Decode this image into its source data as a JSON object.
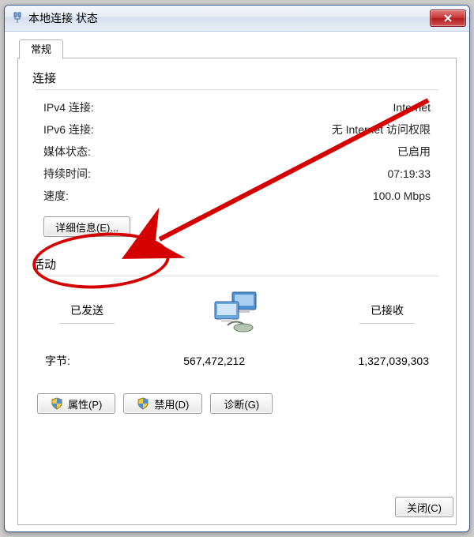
{
  "window": {
    "title": "本地连接 状态",
    "titleicon_name": "network-adapter-icon"
  },
  "tabs": {
    "general": "常规"
  },
  "conn": {
    "section_label": "连接",
    "ipv4_label": "IPv4 连接:",
    "ipv4_value": "Internet",
    "ipv6_label": "IPv6 连接:",
    "ipv6_value": "无 Internet 访问权限",
    "media_label": "媒体状态:",
    "media_value": "已启用",
    "duration_label": "持续时间:",
    "duration_value": "07:19:33",
    "speed_label": "速度:",
    "speed_value": "100.0 Mbps",
    "details_button": "详细信息(E)..."
  },
  "activity": {
    "section_label": "活动",
    "sent_label": "已发送",
    "recv_label": "已接收",
    "bytes_label": "字节:",
    "bytes_sent": "567,472,212",
    "bytes_recv": "1,327,039,303"
  },
  "buttons": {
    "properties": "属性(P)",
    "disable": "禁用(D)",
    "diagnose": "诊断(G)",
    "close": "关闭(C)"
  },
  "annotation": {
    "color": "#d40000"
  }
}
